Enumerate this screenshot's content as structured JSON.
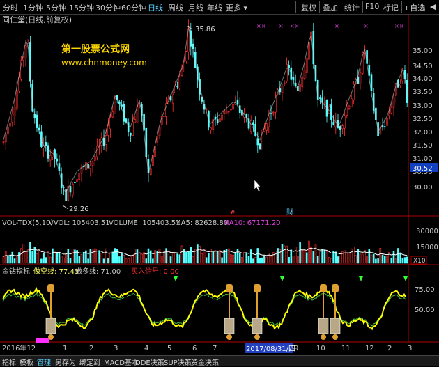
{
  "toolbar": {
    "periods": [
      "分时",
      "1分钟",
      "5分钟",
      "15分钟",
      "30分钟",
      "60分钟",
      "日线",
      "周线",
      "月线",
      "年线",
      "更多"
    ],
    "more_arrow": "▾",
    "active_period": "日线",
    "right_buttons": [
      "复权",
      "叠加",
      "统计",
      "F10",
      "标记",
      "+自选",
      "◀"
    ]
  },
  "main_panel": {
    "stock_title": "同仁堂(日线,前复权)",
    "watermark_title": "第一股票公式网",
    "watermark_url": "www.chnmoney.com",
    "high_label": "35.86",
    "low_label": "29.26",
    "price_axis": [
      "35.00",
      "34.50",
      "34.00",
      "33.50",
      "33.00",
      "32.50",
      "32.00",
      "31.50",
      "31.00",
      "30.50",
      "30.00"
    ],
    "current_price": "30.52",
    "marker_xx": "××",
    "marker_x": "×",
    "event_badge_1": "#",
    "event_badge_2": "财"
  },
  "vol_panel": {
    "name": "VOL-TDX(5,10)",
    "vvol": "VVOL: 105403.51",
    "volume": "VOLUME: 105403.51",
    "ma5": "MA5: 82628.80",
    "ma10": "MA10: 67171.20",
    "axis": [
      "30000",
      "15000"
    ],
    "multiplier": "X10"
  },
  "ind_panel": {
    "name": "金钻指标",
    "short_line": "做空线: 77.43",
    "long_line": "做多线: 71.00",
    "buy_signal": "买入信号: 0.00",
    "axis": [
      "75.00",
      "50.00"
    ]
  },
  "date_axis": {
    "first": "2016年12",
    "labels": [
      "1",
      "2",
      "3",
      "4",
      "5",
      "6",
      "7",
      "8",
      "9",
      "10",
      "11",
      "12",
      "2",
      "3"
    ],
    "selected_date": "2017/08/31/四"
  },
  "bottom_tabs": [
    "指标",
    "模板",
    "管理",
    "另存为",
    "绑定到",
    "MACD基本",
    "DDE决策",
    "SUP决策",
    "资金决策"
  ],
  "bottom_active": "管理",
  "colors": {
    "up": "#ff3232",
    "down": "#54ffff",
    "ma": "#ffffff",
    "accent": "#5ad0ff",
    "yellow": "#ffff00"
  }
}
